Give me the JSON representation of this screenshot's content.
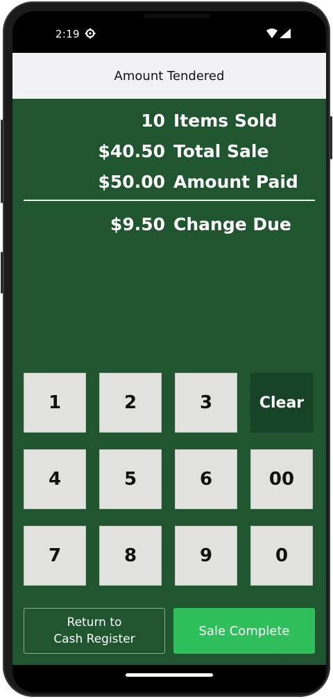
{
  "status_bar": {
    "time": "2:19"
  },
  "header": {
    "title": "Amount Tendered"
  },
  "summary": {
    "rows": [
      {
        "amount": "10",
        "label": "Items Sold"
      },
      {
        "amount": "$40.50",
        "label": "Total Sale"
      },
      {
        "amount": "$50.00",
        "label": "Amount Paid"
      }
    ],
    "change": {
      "amount": "$9.50",
      "label": "Change Due"
    }
  },
  "keypad": {
    "keys": [
      "1",
      "2",
      "3",
      "Clear",
      "4",
      "5",
      "6",
      "00",
      "7",
      "8",
      "9",
      "0"
    ]
  },
  "actions": {
    "return_line1": "Return to",
    "return_line2": "Cash Register",
    "complete": "Sale Complete"
  },
  "colors": {
    "panel_green": "#1f5630",
    "clear_key": "#174326",
    "key_face": "#e1e1dd",
    "complete_green": "#2fbf5a"
  }
}
